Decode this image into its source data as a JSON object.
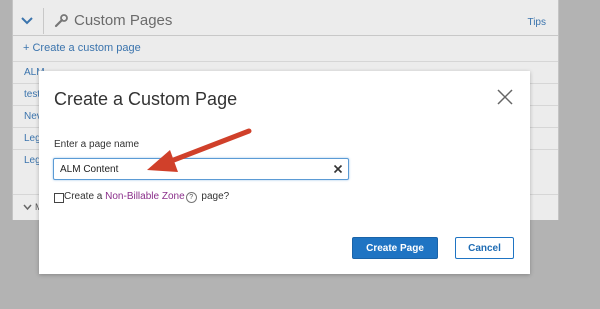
{
  "background": {
    "title": "Custom Pages",
    "tips_label": "Tips",
    "create_link": "+ Create a custom page",
    "rows": [
      "ALM",
      "test",
      "Nev",
      "Leg",
      "Leg"
    ],
    "more_label": "M"
  },
  "modal": {
    "title": "Create a Custom Page",
    "field_label": "Enter a page name",
    "input_value": "ALM Content",
    "checkbox_prefix": "Create a ",
    "checkbox_link": "Non-Billable Zone",
    "help_glyph": "?",
    "checkbox_suffix": " page?",
    "primary_button": "Create Page",
    "secondary_button": "Cancel"
  },
  "colors": {
    "primary": "#1f74c3",
    "link": "#3b74ad",
    "zone_link": "#8b2f8b",
    "annotation_arrow": "#d0402a",
    "accent_bar": "#a3b86a"
  },
  "icons": {
    "header_toggle": "chevron-down-icon",
    "header": "wrench-icon",
    "close": "close-icon",
    "clear": "clear-x-icon",
    "help": "help-circle-icon",
    "annotation": "arrow-icon"
  }
}
